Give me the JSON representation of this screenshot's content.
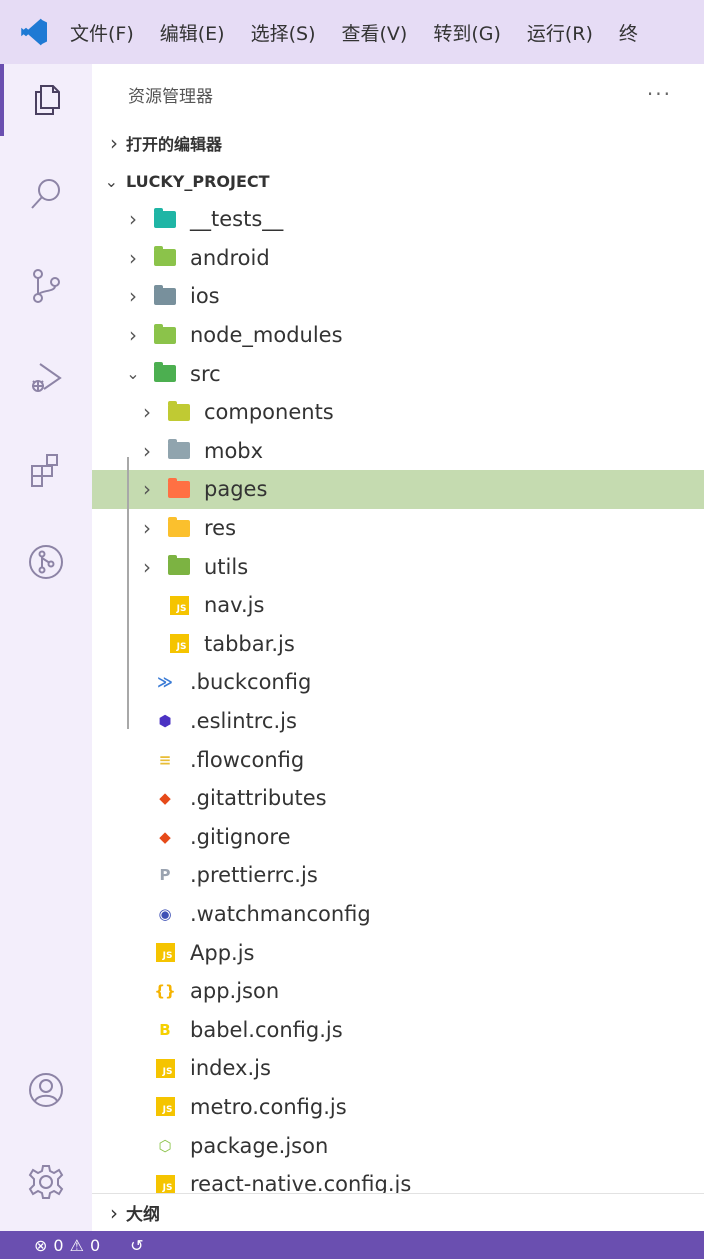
{
  "menu": [
    "文件(F)",
    "编辑(E)",
    "选择(S)",
    "查看(V)",
    "转到(G)",
    "运行(R)",
    "终"
  ],
  "activity": [
    "explorer-icon",
    "search-icon",
    "source-control-icon",
    "run-debug-icon",
    "extensions-icon",
    "gitlens-icon",
    "account-icon",
    "settings-gear-icon"
  ],
  "explorer": {
    "title": "资源管理器",
    "more": "···",
    "open_editors": "打开的编辑器",
    "project": "LUCKY_PROJECT",
    "outline": "大纲"
  },
  "tree": [
    {
      "name": "__tests__",
      "type": "folder",
      "color": "#1fb5a5",
      "depth": 0,
      "expanded": false
    },
    {
      "name": "android",
      "type": "folder",
      "color": "#8bc34a",
      "depth": 0,
      "expanded": false
    },
    {
      "name": "ios",
      "type": "folder",
      "color": "#78909c",
      "depth": 0,
      "expanded": false
    },
    {
      "name": "node_modules",
      "type": "folder",
      "color": "#8bc34a",
      "depth": 0,
      "expanded": false
    },
    {
      "name": "src",
      "type": "folder",
      "color": "#4caf50",
      "depth": 0,
      "expanded": true
    },
    {
      "name": "components",
      "type": "folder",
      "color": "#c0ca33",
      "depth": 1,
      "expanded": false
    },
    {
      "name": "mobx",
      "type": "folder",
      "color": "#90a4ae",
      "depth": 1,
      "expanded": false
    },
    {
      "name": "pages",
      "type": "folder",
      "color": "#ff7043",
      "depth": 1,
      "expanded": false,
      "selected": true
    },
    {
      "name": "res",
      "type": "folder",
      "color": "#fbc02d",
      "depth": 1,
      "expanded": false
    },
    {
      "name": "utils",
      "type": "folder",
      "color": "#7cb342",
      "depth": 1,
      "expanded": false
    },
    {
      "name": "nav.js",
      "type": "js",
      "depth": 1
    },
    {
      "name": "tabbar.js",
      "type": "js",
      "depth": 1
    },
    {
      "name": ".buckconfig",
      "type": "buck",
      "depth": 0
    },
    {
      "name": ".eslintrc.js",
      "type": "eslint",
      "depth": 0
    },
    {
      "name": ".flowconfig",
      "type": "flow",
      "depth": 0
    },
    {
      "name": ".gitattributes",
      "type": "git",
      "depth": 0
    },
    {
      "name": ".gitignore",
      "type": "git",
      "depth": 0
    },
    {
      "name": ".prettierrc.js",
      "type": "prettier",
      "depth": 0
    },
    {
      "name": ".watchmanconfig",
      "type": "watchman",
      "depth": 0
    },
    {
      "name": "App.js",
      "type": "js",
      "depth": 0
    },
    {
      "name": "app.json",
      "type": "json",
      "depth": 0
    },
    {
      "name": "babel.config.js",
      "type": "babel",
      "depth": 0
    },
    {
      "name": "index.js",
      "type": "js",
      "depth": 0
    },
    {
      "name": "metro.config.js",
      "type": "js",
      "depth": 0
    },
    {
      "name": "package.json",
      "type": "node",
      "depth": 0
    },
    {
      "name": "react-native.config.js",
      "type": "js",
      "depth": 0
    }
  ],
  "status": {
    "errors": "0",
    "warnings": "0"
  },
  "colors": {
    "accent": "#6a4fb0",
    "selected": "#c5dbb0",
    "titlebar": "#e6dcf5"
  }
}
